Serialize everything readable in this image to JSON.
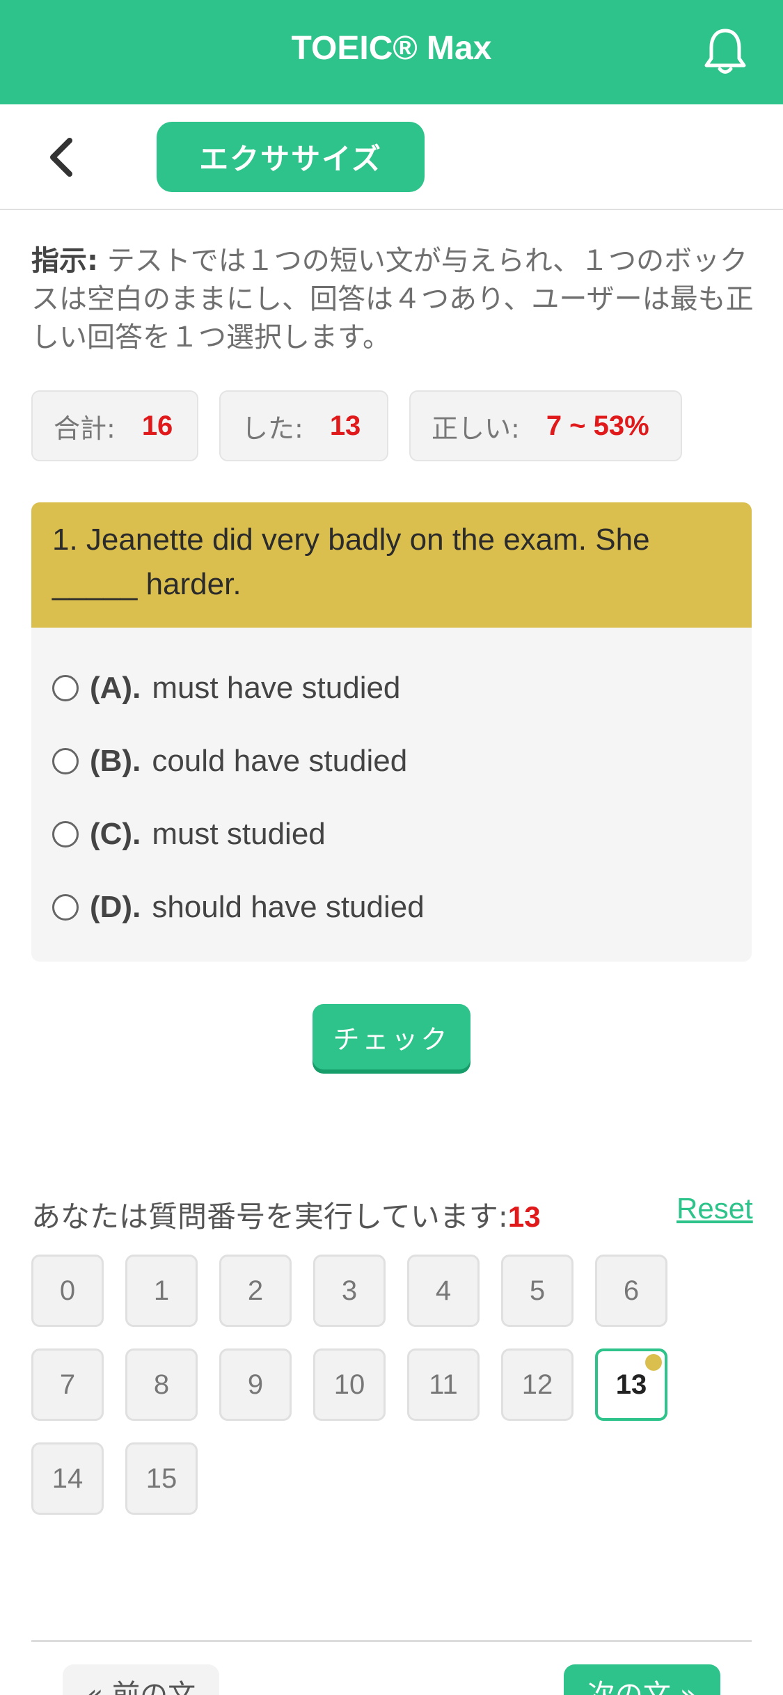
{
  "header": {
    "title": "TOEIC® Max",
    "notification_icon": "bell-icon"
  },
  "subheader": {
    "back_icon": "chevron-left-icon",
    "exercise_label": "エクササイズ"
  },
  "instruction": {
    "prefix": "指示:",
    "text": " テストでは１つの短い文が与えられ、１つのボックスは空白のままにし、回答は４つあり、ユーザーは最も正しい回答を１つ選択します。"
  },
  "stats": {
    "total_label": "合計:",
    "total_value": "16",
    "done_label": "した:",
    "done_value": "13",
    "correct_label": "正しい:",
    "correct_value": "7 ~ 53%"
  },
  "question": {
    "text": "1. Jeanette did very badly on the exam. She _____ harder.",
    "options": [
      {
        "label": "(A).",
        "text": "must have studied"
      },
      {
        "label": "(B).",
        "text": "could have studied"
      },
      {
        "label": "(C).",
        "text": "must studied"
      },
      {
        "label": "(D).",
        "text": "should have studied"
      }
    ]
  },
  "check_label": "チェック",
  "progress": {
    "label": "あなたは質問番号を実行しています:",
    "current": "13",
    "reset_label": "Reset",
    "numbers": [
      "0",
      "1",
      "2",
      "3",
      "4",
      "5",
      "6",
      "7",
      "8",
      "9",
      "10",
      "11",
      "12",
      "13",
      "14",
      "15"
    ],
    "active_index": 13
  },
  "nav": {
    "prev_label": "« 前の文",
    "next_label": "次の文 »"
  },
  "colors": {
    "brand": "#2dc38a",
    "question_header": "#dbbf4e",
    "highlight_number": "#e0191b"
  }
}
